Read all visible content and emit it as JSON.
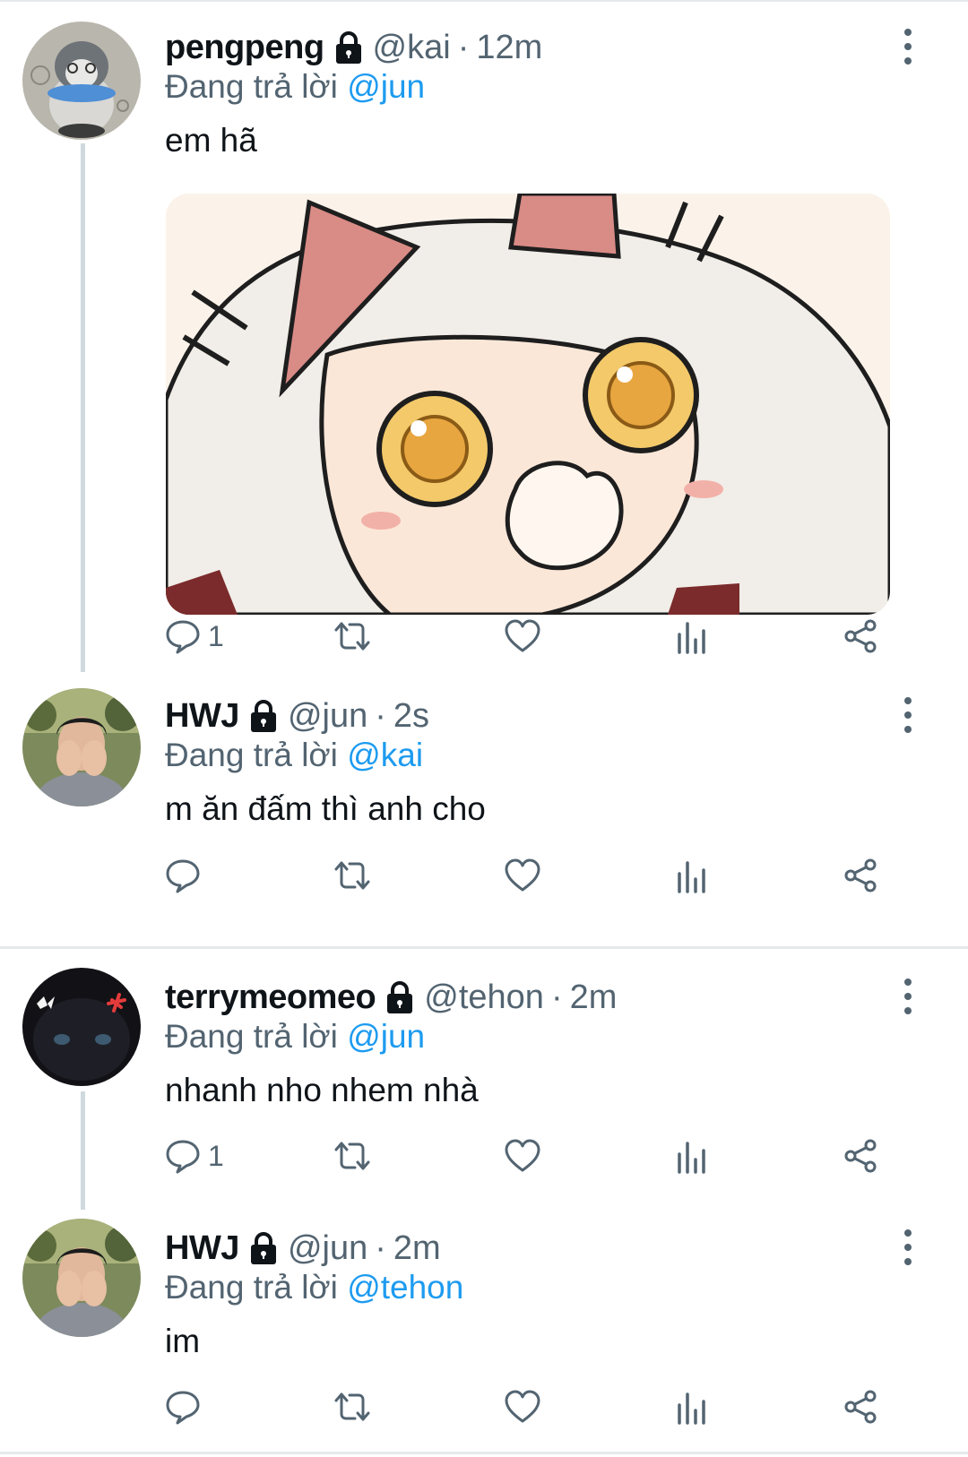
{
  "reply_prefix": "Đang trả lời",
  "tweets": [
    {
      "name": "pengpeng",
      "handle": "@kai",
      "dot": "·",
      "time": "12m",
      "reply_to": "@jun",
      "text": "em hã",
      "reply_count": "1",
      "has_media": true,
      "avatar": "penguin-plush-avatar"
    },
    {
      "name": "HWJ",
      "handle": "@jun",
      "dot": "·",
      "time": "2s",
      "reply_to": "@kai",
      "text": "m ăn đấm thì anh cho",
      "reply_count": "",
      "has_media": false,
      "avatar": "person-covering-face-avatar"
    },
    {
      "name": "terrymeomeo",
      "handle": "@tehon",
      "dot": "·",
      "time": "2m",
      "reply_to": "@jun",
      "text": "nhanh nho nhem nhà",
      "reply_count": "1",
      "has_media": false,
      "avatar": "black-cat-avatar"
    },
    {
      "name": "HWJ",
      "handle": "@jun",
      "dot": "·",
      "time": "2m",
      "reply_to": "@tehon",
      "text": "im",
      "reply_count": "",
      "has_media": false,
      "avatar": "person-covering-face-avatar"
    }
  ],
  "icons": {
    "reply": "reply-icon",
    "retweet": "retweet-icon",
    "like": "heart-icon",
    "views": "analytics-icon",
    "share": "share-icon",
    "lock": "lock-icon",
    "more": "more-vertical-icon"
  },
  "colors": {
    "text": "#0f1419",
    "secondary": "#536471",
    "link": "#1d9bf0",
    "thread_line": "#cfd9de",
    "divider": "#e6e9ea"
  }
}
